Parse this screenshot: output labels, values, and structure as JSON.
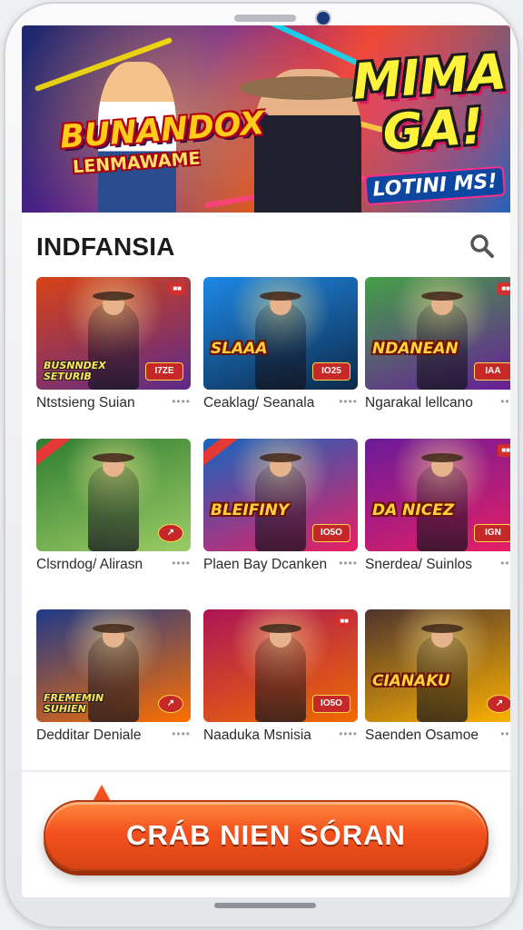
{
  "banner": {
    "title": "BUNANDOX",
    "subtitle": "LENMAWAME",
    "right_title": "MIMA GA!",
    "right_subtitle": "LOTINI MS!"
  },
  "section": {
    "title": "INDFANSIA",
    "search_icon": "search-icon"
  },
  "games": [
    {
      "name": "Ntstsieng Suian",
      "thumb_text": "BUSNNDEX SETURIB",
      "badge": "I7ZE",
      "colors": [
        "#d84315",
        "#5d2a8a"
      ]
    },
    {
      "name": "Ceaklag/ Seanala",
      "thumb_text": "SLAAA",
      "badge": "IO25",
      "colors": [
        "#1e88e5",
        "#0d2a4a"
      ]
    },
    {
      "name": "Ngarakal lellcano",
      "thumb_text": "NDANEAN",
      "badge": "IAA",
      "colors": [
        "#43a047",
        "#6a1b9a"
      ]
    },
    {
      "name": "Clsrndog/ Alirasn",
      "thumb_text": "",
      "badge": "",
      "colors": [
        "#2e7d32",
        "#9ccc65"
      ]
    },
    {
      "name": "Plaen Bay Dcanken",
      "thumb_text": "BLEIFINY",
      "badge": "IO5O",
      "colors": [
        "#1565c0",
        "#e91e63"
      ]
    },
    {
      "name": "Snerdea/ Suinlos",
      "thumb_text": "DA NICEZ",
      "badge": "IGN",
      "colors": [
        "#6a1b9a",
        "#e91e63"
      ]
    },
    {
      "name": "Dedditar Deniale",
      "thumb_text": "FREMEMIN SUHIEN",
      "badge": "",
      "colors": [
        "#1e3a8a",
        "#ff6f00"
      ]
    },
    {
      "name": "Naaduka Msnisia",
      "thumb_text": "",
      "badge": "IO5O",
      "colors": [
        "#ad1457",
        "#ef6c00"
      ]
    },
    {
      "name": "Saenden Osamoe",
      "thumb_text": "CIANAKU",
      "badge": "",
      "colors": [
        "#4e342e",
        "#ffb300"
      ]
    }
  ],
  "cta": {
    "label": "CRÁB NIEN SÓRAN"
  }
}
